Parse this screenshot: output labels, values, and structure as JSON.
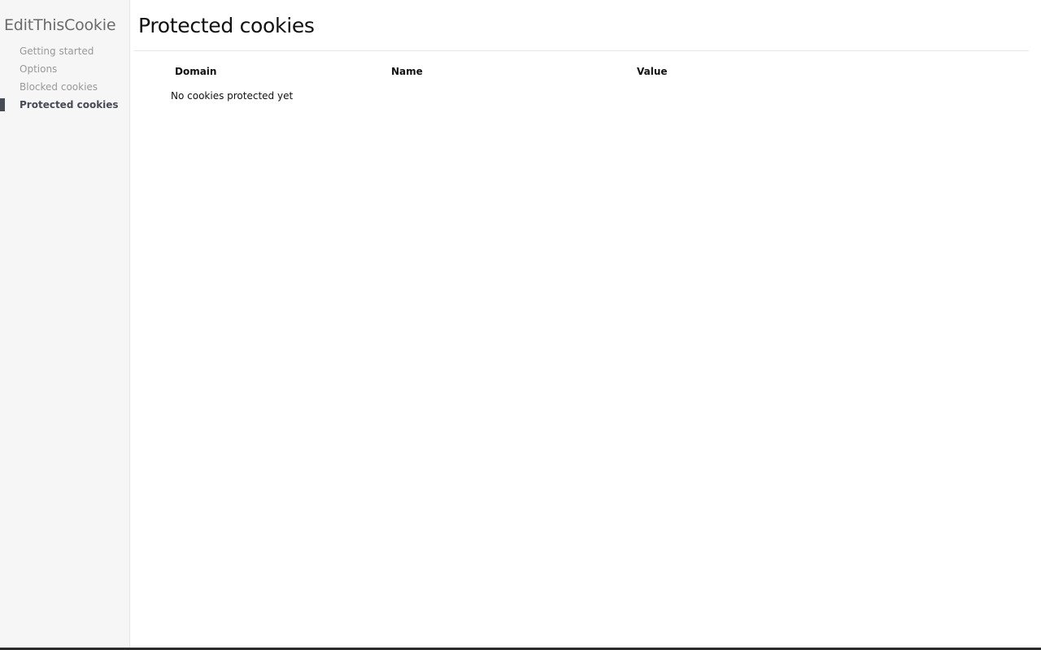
{
  "sidebar": {
    "brand": "EditThisCookie",
    "items": [
      {
        "label": "Getting started"
      },
      {
        "label": "Options"
      },
      {
        "label": "Blocked cookies"
      },
      {
        "label": "Protected cookies"
      }
    ],
    "active_index": 3
  },
  "main": {
    "title": "Protected cookies",
    "table": {
      "headers": [
        "Domain",
        "Name",
        "Value"
      ],
      "empty_message": "No cookies protected yet"
    }
  },
  "colors": {
    "sidebar_bg": "#f6f6f6",
    "active": "#464b55",
    "inactive": "#999999"
  }
}
